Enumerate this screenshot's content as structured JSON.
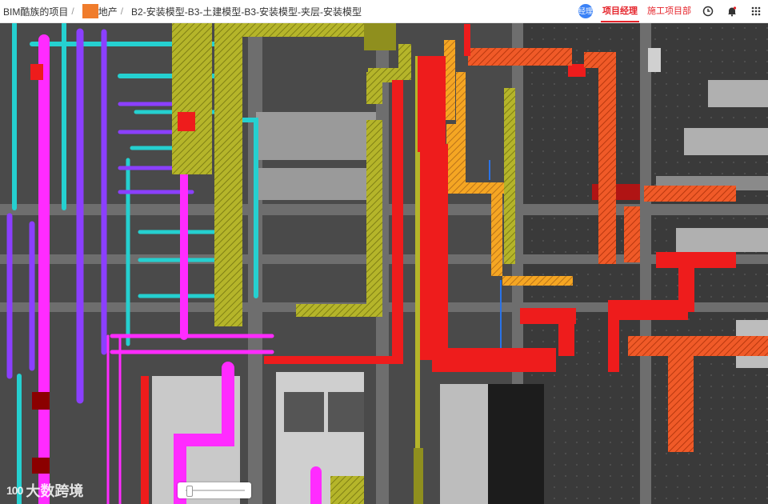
{
  "breadcrumb": {
    "items": [
      "BIM酷族的项目",
      "地产",
      "B2-安装模型-B3-土建模型-B3-安装模型-夹层-安装模型"
    ],
    "separator": "/"
  },
  "user": {
    "avatar_text": "经理"
  },
  "roles": {
    "active": "项目经理",
    "other": "施工项目部"
  },
  "icons": {
    "history": "clock-icon",
    "notify": "bell-icon",
    "menu": "grid-icon"
  },
  "watermark": {
    "logo": "100",
    "text": "大数跨境"
  },
  "viewer": {
    "slider_value": 0.05
  },
  "colors": {
    "accent": "#e5232a",
    "duct_red": "#ee1c1c",
    "duct_orange": "#f05a28",
    "duct_olive": "#b5b52a",
    "pipe_magenta": "#ff2bff",
    "pipe_purple": "#8b3fff",
    "pipe_cyan": "#25d0d0"
  }
}
